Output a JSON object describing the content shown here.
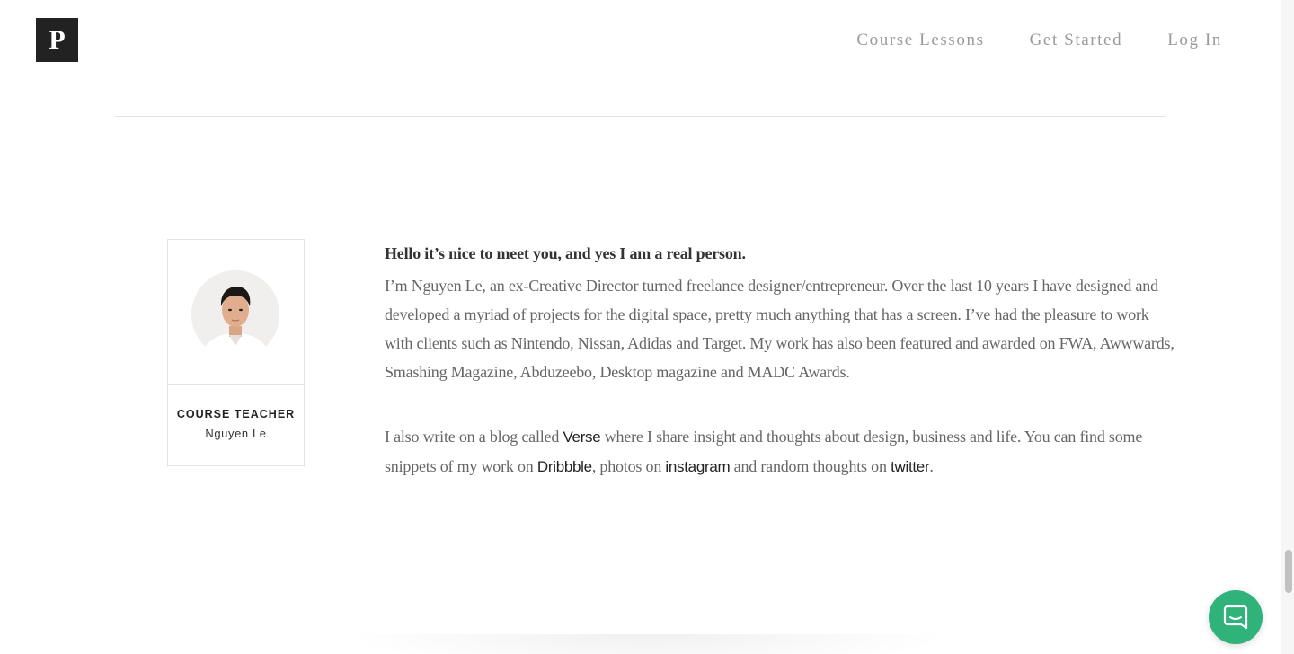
{
  "header": {
    "logo_letter": "P",
    "nav": [
      {
        "label": "Course Lessons"
      },
      {
        "label": "Get Started"
      },
      {
        "label": "Log In"
      }
    ]
  },
  "teacher_card": {
    "role": "COURSE TEACHER",
    "name": "Nguyen Le"
  },
  "bio": {
    "heading": "Hello it’s nice to meet you, and yes I am a real person.",
    "paragraph1": "I’m Nguyen Le, an ex-Creative Director turned freelance designer/entrepreneur. Over the last 10 years I have designed and developed a myriad of projects for the digital space, pretty much anything that has a screen. I’ve had the pleasure to work with clients such as Nintendo, Nissan, Adidas and Target. My work has also been featured and awarded on FWA, Awwwards, Smashing Magazine, Abduzeebo, Desktop magazine and MADC Awards.",
    "paragraph2": {
      "part1": "I also write on a blog called ",
      "link_verse": "Verse",
      "part2": " where I share insight and thoughts about design, business and life. You can find some snippets of my work on ",
      "link_dribbble": "Dribbble",
      "part3": ", photos on ",
      "link_instagram": "instagram",
      "part4": " and random thoughts on ",
      "link_twitter": "twitter",
      "part5": "."
    }
  },
  "colors": {
    "chat_accent": "#2fb37a",
    "logo_bg": "#222222"
  },
  "icons": {
    "chat": "chat-bubble-icon"
  }
}
